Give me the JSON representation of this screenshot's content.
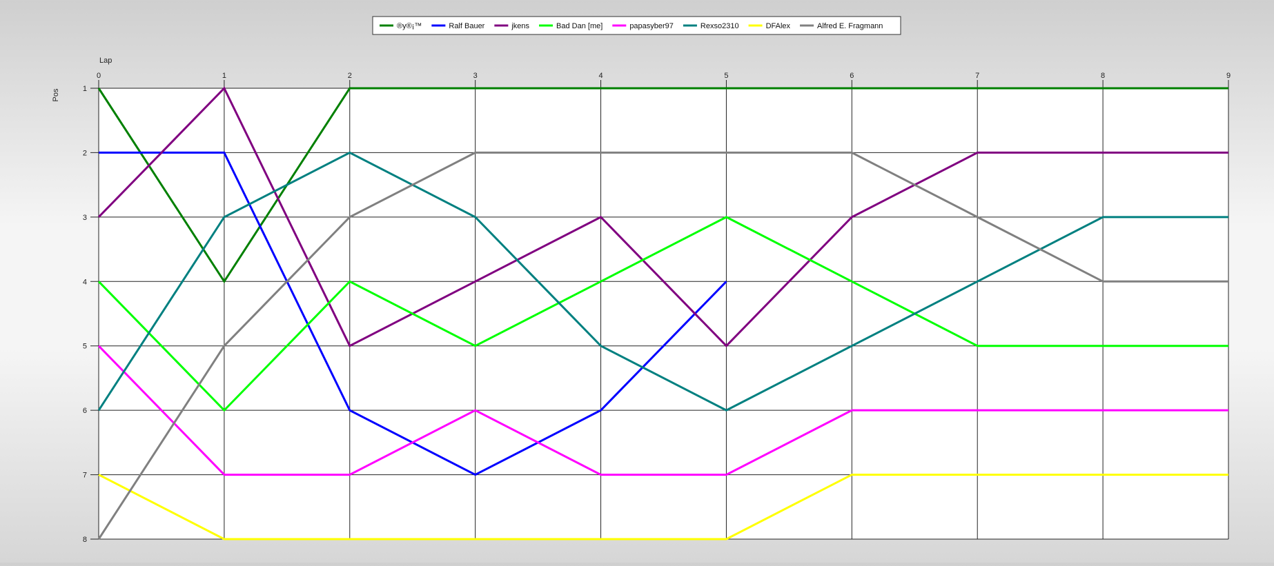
{
  "chart_data": {
    "type": "line",
    "title": "",
    "xlabel": "Lap",
    "ylabel": "Pos",
    "x": [
      0,
      1,
      2,
      3,
      4,
      5,
      6,
      7,
      8,
      9
    ],
    "xlim": [
      0,
      9
    ],
    "ylim": [
      1,
      8
    ],
    "y_inverted": true,
    "yticks": [
      1,
      2,
      3,
      4,
      5,
      6,
      7,
      8
    ],
    "grid": true,
    "legend_position": "top-center",
    "series": [
      {
        "name": "®y®¡™",
        "color": "#008000",
        "values": [
          1,
          4,
          1,
          1,
          1,
          1,
          1,
          1,
          1,
          1
        ]
      },
      {
        "name": "Ralf Bauer",
        "color": "#0000ff",
        "values": [
          2,
          2,
          6,
          7,
          6,
          4,
          null,
          null,
          null,
          null
        ]
      },
      {
        "name": "jkens",
        "color": "#800080",
        "values": [
          3,
          1,
          5,
          4,
          3,
          5,
          3,
          2,
          2,
          2
        ]
      },
      {
        "name": "Bad Dan [me]",
        "color": "#00ff00",
        "values": [
          4,
          6,
          4,
          5,
          4,
          3,
          4,
          5,
          5,
          5
        ]
      },
      {
        "name": "papasyber97",
        "color": "#ff00ff",
        "values": [
          5,
          7,
          7,
          6,
          7,
          7,
          6,
          6,
          6,
          6
        ]
      },
      {
        "name": "Rexso2310",
        "color": "#008080",
        "values": [
          6,
          3,
          2,
          3,
          5,
          6,
          5,
          4,
          3,
          3
        ]
      },
      {
        "name": "DFAlex",
        "color": "#ffff00",
        "values": [
          7,
          8,
          8,
          8,
          8,
          8,
          7,
          7,
          7,
          7
        ]
      },
      {
        "name": "Alfred E. Fragmann",
        "color": "#808080",
        "values": [
          8,
          5,
          3,
          2,
          2,
          2,
          2,
          3,
          4,
          4
        ]
      }
    ]
  }
}
